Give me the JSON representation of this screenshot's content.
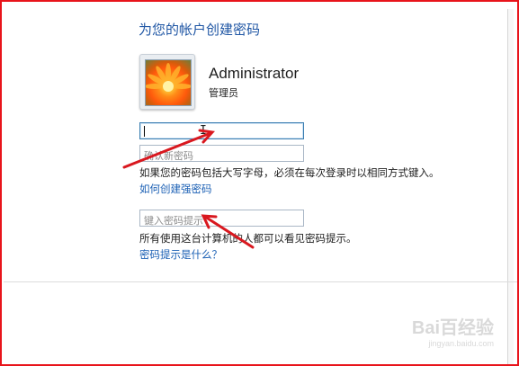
{
  "dialog": {
    "title": "为您的帐户创建密码"
  },
  "user": {
    "name": "Administrator",
    "role": "管理员",
    "avatar_icon": "user-avatar-flower-icon"
  },
  "password": {
    "value": "",
    "placeholder": ""
  },
  "confirm_password": {
    "value": "",
    "placeholder": "确认新密码"
  },
  "hints": {
    "case_notice": "如果您的密码包括大写字母，必须在每次登录时以相同方式键入。",
    "strong_password_link": "如何创建强密码",
    "hint_placeholder": "键入密码提示",
    "hint_notice": "所有使用这台计算机的人都可以看见密码提示。",
    "what_is_hint_link": "密码提示是什么？"
  },
  "watermark": {
    "main": "Bai百经验",
    "sub": "jingyan.baidu.com"
  },
  "colors": {
    "frame_border": "#e8141b",
    "title": "#1f56a4",
    "link": "#1a5fb4",
    "arrow": "#d9181f"
  }
}
